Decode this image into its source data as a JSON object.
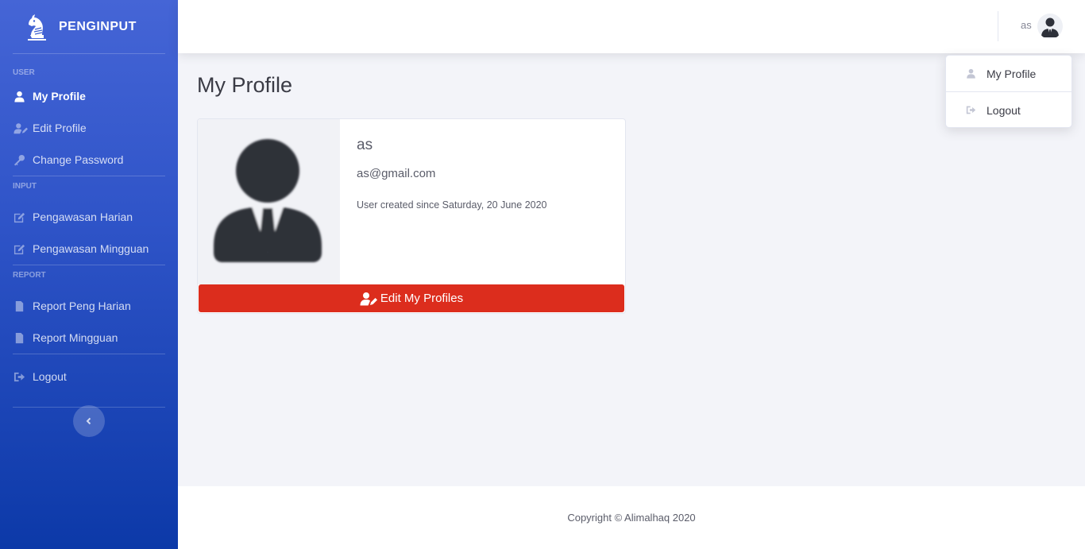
{
  "brand": {
    "name": "PENGINPUT",
    "icon": "chess-knight-icon"
  },
  "sidebar": {
    "sections": [
      {
        "heading": "USER",
        "items": [
          {
            "label": "My Profile",
            "icon": "user-icon",
            "active": true
          },
          {
            "label": "Edit Profile",
            "icon": "user-edit-icon"
          },
          {
            "label": "Change Password",
            "icon": "key-icon"
          }
        ]
      },
      {
        "heading": "INPUT",
        "items": [
          {
            "label": "Pengawasan Harian",
            "icon": "edit-icon"
          },
          {
            "label": "Pengawasan Mingguan",
            "icon": "edit-icon"
          }
        ]
      },
      {
        "heading": "REPORT",
        "items": [
          {
            "label": "Report Peng Harian",
            "icon": "file-icon"
          },
          {
            "label": "Report Mingguan",
            "icon": "file-icon"
          }
        ]
      }
    ],
    "logout": {
      "label": "Logout",
      "icon": "sign-out-icon"
    },
    "toggle_icon": "chevron-left-icon"
  },
  "topbar": {
    "user_name": "as",
    "avatar_icon": "user-avatar-icon"
  },
  "dropdown": {
    "items": [
      {
        "label": "My Profile",
        "icon": "user-icon"
      },
      {
        "label": "Logout",
        "icon": "sign-out-icon"
      }
    ]
  },
  "main": {
    "title": "My Profile",
    "profile": {
      "name": "as",
      "email": "as@gmail.com",
      "created": "User created since Saturday, 20 June 2020",
      "edit_button": "Edit My Profiles"
    }
  },
  "footer": {
    "copyright": "Copyright © Alimalhaq 2020"
  },
  "colors": {
    "sidebar_top": "#4565d6",
    "sidebar_bottom": "#0c39a8",
    "danger": "#dc2d1d",
    "background": "#f3f4f9"
  }
}
